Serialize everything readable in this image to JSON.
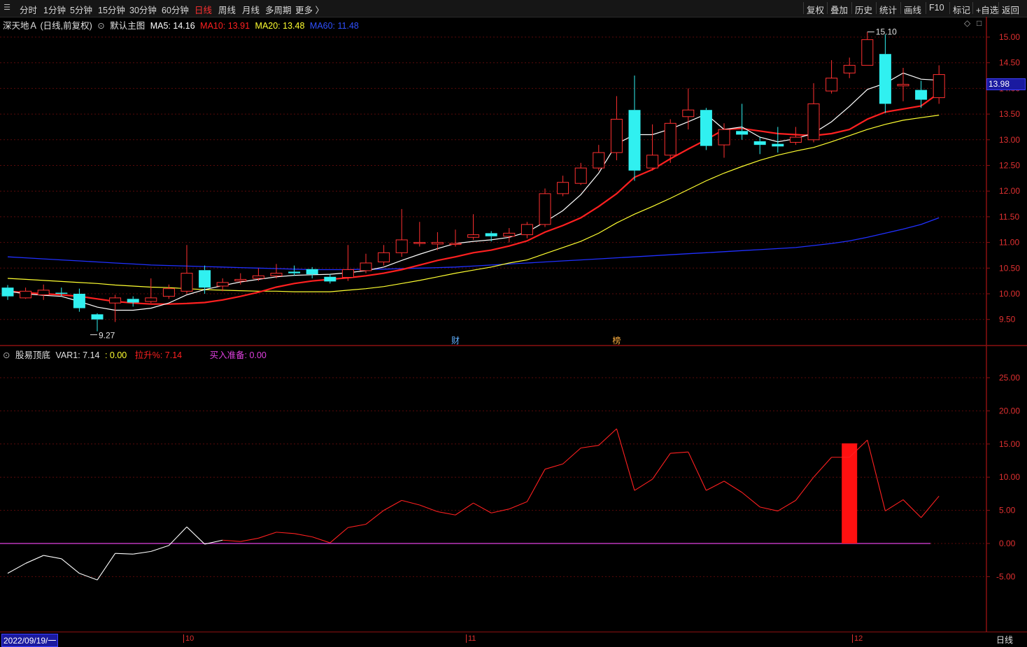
{
  "toolbar": {
    "periods": [
      "分时",
      "1分钟",
      "5分钟",
      "15分钟",
      "30分钟",
      "60分钟",
      "日线",
      "周线",
      "月线",
      "多周期",
      "更多 〉"
    ],
    "active_period": "日线",
    "right_buttons": [
      "复权",
      "叠加",
      "历史",
      "统计",
      "画线",
      "F10",
      "标记",
      "+自选",
      "返回"
    ]
  },
  "main_chart": {
    "stock": "深天地Ａ (日线,前复权)",
    "template": "默认主图",
    "ma": [
      {
        "label": "MA5: 14.16",
        "color": "#ffffff"
      },
      {
        "label": "MA10: 13.91",
        "color": "#ff2020"
      },
      {
        "label": "MA20: 13.48",
        "color": "#ffff30"
      },
      {
        "label": "MA60: 11.48",
        "color": "#3050ff"
      }
    ],
    "high_marker": "15.10",
    "low_marker": "9.27",
    "current_price": "13.98",
    "y_ticks": [
      "15.00",
      "14.50",
      "14.00",
      "13.50",
      "13.00",
      "12.50",
      "12.00",
      "11.50",
      "11.00",
      "10.50",
      "10.00",
      "9.50"
    ],
    "events": [
      {
        "label": "财",
        "color": "#60b0ff"
      },
      {
        "label": "榜",
        "color": "#ffb040"
      }
    ],
    "colors": {
      "up": "#ff3030",
      "down": "#30f0f0",
      "ma5": "#ffffff",
      "ma10": "#ff2020",
      "ma20": "#ffff30",
      "ma60": "#2030ff"
    }
  },
  "sub_chart": {
    "name": "股易顶底",
    "var1": "VAR1: 7.14",
    "var1_extra": ": 0.00",
    "rise": "拉升%: 7.14",
    "buy": "买入准备: 0.00",
    "y_ticks": [
      "25.00",
      "20.00",
      "15.00",
      "10.00",
      "5.00",
      "0.00",
      "-5.00"
    ]
  },
  "date_axis": {
    "start_date": "2022/09/19/一",
    "months": [
      "10",
      "11",
      "12"
    ],
    "period_label": "日线"
  },
  "chart_data": {
    "type": "candlestick",
    "candles": [
      [
        10.12,
        9.95,
        10.17,
        9.88
      ],
      [
        9.92,
        10.05,
        10.12,
        9.9
      ],
      [
        9.98,
        10.07,
        10.18,
        9.88
      ],
      [
        10.02,
        10.0,
        10.12,
        9.95
      ],
      [
        10.0,
        9.72,
        10.1,
        9.65
      ],
      [
        9.6,
        9.5,
        9.62,
        9.27
      ],
      [
        9.82,
        9.92,
        9.98,
        9.45
      ],
      [
        9.9,
        9.83,
        9.95,
        9.75
      ],
      [
        9.85,
        9.92,
        10.3,
        9.82
      ],
      [
        9.95,
        10.1,
        10.18,
        9.9
      ],
      [
        10.05,
        10.4,
        10.95,
        10.0
      ],
      [
        10.46,
        10.12,
        10.55,
        10.0
      ],
      [
        10.15,
        10.22,
        10.3,
        10.05
      ],
      [
        10.25,
        10.28,
        10.4,
        10.18
      ],
      [
        10.3,
        10.35,
        10.5,
        10.25
      ],
      [
        10.35,
        10.4,
        10.58,
        10.3
      ],
      [
        10.43,
        10.4,
        10.55,
        10.35
      ],
      [
        10.48,
        10.38,
        10.52,
        10.3
      ],
      [
        10.33,
        10.24,
        10.38,
        10.2
      ],
      [
        10.32,
        10.47,
        10.95,
        10.25
      ],
      [
        10.45,
        10.6,
        10.78,
        10.4
      ],
      [
        10.62,
        10.8,
        10.95,
        10.55
      ],
      [
        10.8,
        11.05,
        11.65,
        10.72
      ],
      [
        10.98,
        11.0,
        11.4,
        10.92
      ],
      [
        10.97,
        11.0,
        11.2,
        10.85
      ],
      [
        10.98,
        10.98,
        11.25,
        10.92
      ],
      [
        11.1,
        11.15,
        11.55,
        11.05
      ],
      [
        11.18,
        11.12,
        11.22,
        11.02
      ],
      [
        11.12,
        11.18,
        11.28,
        11.0
      ],
      [
        11.15,
        11.35,
        11.4,
        11.08
      ],
      [
        11.35,
        11.95,
        12.05,
        11.3
      ],
      [
        11.95,
        12.17,
        12.3,
        11.9
      ],
      [
        12.15,
        12.45,
        12.55,
        12.12
      ],
      [
        12.45,
        12.75,
        12.9,
        12.4
      ],
      [
        12.75,
        13.4,
        13.85,
        12.6
      ],
      [
        13.58,
        12.4,
        14.25,
        12.2
      ],
      [
        12.45,
        12.7,
        13.3,
        12.4
      ],
      [
        12.7,
        13.32,
        13.4,
        12.55
      ],
      [
        13.45,
        13.58,
        14.0,
        13.2
      ],
      [
        13.58,
        12.88,
        13.62,
        12.8
      ],
      [
        12.9,
        13.2,
        13.32,
        12.65
      ],
      [
        13.17,
        13.1,
        13.7,
        13.0
      ],
      [
        12.97,
        12.9,
        13.05,
        12.72
      ],
      [
        12.92,
        12.87,
        13.25,
        12.75
      ],
      [
        12.95,
        13.05,
        13.25,
        12.9
      ],
      [
        13.0,
        13.7,
        14.1,
        12.95
      ],
      [
        13.95,
        14.2,
        14.55,
        13.9
      ],
      [
        14.3,
        14.45,
        14.6,
        14.2
      ],
      [
        14.45,
        14.95,
        15.1,
        14.45
      ],
      [
        14.67,
        13.7,
        15.05,
        13.52
      ],
      [
        14.05,
        14.08,
        14.4,
        13.75
      ],
      [
        13.97,
        13.78,
        14.15,
        13.62
      ],
      [
        13.82,
        14.27,
        14.45,
        13.7
      ]
    ],
    "ma5": [
      10.05,
      10.0,
      9.97,
      9.95,
      9.85,
      9.74,
      9.68,
      9.68,
      9.72,
      9.82,
      9.98,
      10.08,
      10.16,
      10.23,
      10.28,
      10.33,
      10.36,
      10.37,
      10.38,
      10.41,
      10.45,
      10.52,
      10.65,
      10.77,
      10.88,
      10.98,
      11.02,
      11.05,
      11.1,
      11.2,
      11.4,
      11.62,
      11.93,
      12.35,
      12.92,
      13.1,
      13.1,
      13.21,
      13.35,
      13.5,
      13.2,
      13.25,
      13.05,
      12.96,
      13.02,
      13.13,
      13.35,
      13.65,
      13.98,
      14.1,
      14.3,
      14.18,
      14.16
    ],
    "ma10": [
      10.05,
      10.02,
      10.0,
      9.98,
      9.95,
      9.9,
      9.85,
      9.82,
      9.8,
      9.8,
      9.81,
      9.83,
      9.88,
      9.95,
      10.03,
      10.13,
      10.2,
      10.25,
      10.28,
      10.31,
      10.35,
      10.4,
      10.47,
      10.56,
      10.65,
      10.72,
      10.8,
      10.85,
      10.93,
      11.03,
      11.2,
      11.33,
      11.48,
      11.7,
      11.95,
      12.27,
      12.42,
      12.63,
      12.82,
      13.0,
      13.2,
      13.22,
      13.17,
      13.12,
      13.1,
      13.08,
      13.12,
      13.2,
      13.4,
      13.54,
      13.6,
      13.66,
      13.91
    ],
    "ma20": [
      10.3,
      10.28,
      10.26,
      10.24,
      10.22,
      10.2,
      10.17,
      10.15,
      10.13,
      10.12,
      10.1,
      10.08,
      10.07,
      10.06,
      10.05,
      10.05,
      10.04,
      10.04,
      10.04,
      10.07,
      10.1,
      10.14,
      10.2,
      10.26,
      10.33,
      10.4,
      10.46,
      10.52,
      10.6,
      10.66,
      10.78,
      10.9,
      11.02,
      11.18,
      11.38,
      11.55,
      11.7,
      11.86,
      12.03,
      12.2,
      12.35,
      12.48,
      12.6,
      12.7,
      12.78,
      12.85,
      12.96,
      13.08,
      13.2,
      13.3,
      13.38,
      13.43,
      13.48
    ],
    "ma60": [
      10.72,
      10.7,
      10.68,
      10.66,
      10.64,
      10.62,
      10.6,
      10.58,
      10.56,
      10.55,
      10.54,
      10.53,
      10.52,
      10.51,
      10.5,
      10.49,
      10.48,
      10.47,
      10.47,
      10.47,
      10.48,
      10.48,
      10.49,
      10.5,
      10.51,
      10.52,
      10.54,
      10.56,
      10.58,
      10.6,
      10.62,
      10.64,
      10.66,
      10.68,
      10.7,
      10.72,
      10.74,
      10.76,
      10.78,
      10.8,
      10.82,
      10.84,
      10.86,
      10.88,
      10.9,
      10.94,
      10.98,
      11.03,
      11.1,
      11.18,
      11.26,
      11.35,
      11.48
    ],
    "var1": [
      -4.5,
      -3.0,
      -1.8,
      -2.3,
      -4.5,
      -5.5,
      -1.5,
      -1.6,
      -1.2,
      -0.3,
      2.5,
      -0.1,
      0.5,
      0.3,
      0.8,
      1.7,
      1.5,
      1.0,
      0.1,
      2.4,
      2.9,
      5.0,
      6.5,
      5.8,
      4.8,
      4.3,
      6.1,
      4.6,
      5.2,
      6.3,
      11.2,
      12.0,
      14.4,
      14.8,
      17.3,
      8.0,
      9.7,
      13.6,
      13.8,
      8.0,
      9.4,
      7.7,
      5.5,
      4.9,
      6.5,
      10.0,
      13.0,
      13.0,
      15.6,
      4.9,
      6.6,
      3.9,
      7.14
    ],
    "buy_signal_index": 47,
    "buy_signal_value": 15.1
  }
}
